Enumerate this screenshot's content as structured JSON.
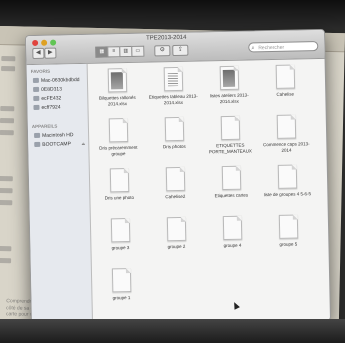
{
  "window": {
    "title": "TPE2013-2014"
  },
  "toolbar": {
    "back_label": "◀",
    "forward_label": "▶",
    "view_modes": [
      "▦",
      "≡",
      "▥",
      "▭"
    ],
    "action_label": "⚙",
    "share_label": "⇪",
    "search_placeholder": "Rechercher"
  },
  "sidebar": {
    "favorites_heading": "Favoris",
    "favorites": [
      {
        "label": "Mac-0630kbdbdd",
        "icon": "computer-icon"
      },
      {
        "label": "0E8D313",
        "icon": "drive-icon"
      },
      {
        "label": "ecFE432",
        "icon": "drive-icon"
      },
      {
        "label": "ecff7924",
        "icon": "drive-icon"
      }
    ],
    "devices_heading": "Appareils",
    "devices": [
      {
        "label": "Macintosh HD",
        "icon": "hard-drive-icon"
      },
      {
        "label": "BOOTCAMP",
        "icon": "drive-icon"
      }
    ]
  },
  "files": [
    {
      "name": "Bilquettes rallonés 2014.xlsx",
      "style": "gray"
    },
    {
      "name": "Etiquettes tableau 2013-2014.xlsx",
      "style": "thumb"
    },
    {
      "name": "listes ateliers 2013-2014.xlsx",
      "style": "gray"
    },
    {
      "name": "Cahelise",
      "style": "plain"
    },
    {
      "name": "Dris précaremment groupe",
      "style": "plain"
    },
    {
      "name": "Dris photos",
      "style": "plain"
    },
    {
      "name": "ETIQUETTES PORTE_MANTEAUX",
      "style": "plain"
    },
    {
      "name": "Commence caps 2013-2014",
      "style": "plain"
    },
    {
      "name": "Dris une photo",
      "style": "plain"
    },
    {
      "name": "Cahelise2",
      "style": "plain"
    },
    {
      "name": "Etiquettes cartes",
      "style": "plain"
    },
    {
      "name": "liste de groupes 4 5-6-5",
      "style": "plain"
    },
    {
      "name": "groupe 3",
      "style": "plain"
    },
    {
      "name": "groupe 2",
      "style": "plain"
    },
    {
      "name": "groupe 4",
      "style": "plain"
    },
    {
      "name": "groupe 5",
      "style": "plain"
    },
    {
      "name": "groupe 1",
      "style": "plain"
    }
  ],
  "background_doc": {
    "bottom_text": "Comprendre que le but est de reconstituer le même collier que celui du modèle... Prendre des anneaux dans la boîte et les poser à côté de sa carte. Une consigne de 1 pour 4 anneaux de chaque catégorie (exemple : tous figés et un groupe). Poser les anneaux sur la carte pour valider."
  },
  "colors": {
    "close": "#e0443e",
    "minimize": "#dea123",
    "maximize": "#61c554",
    "sidebar_bg": "#e6e9ee",
    "window_bg": "#f4f4f3"
  }
}
